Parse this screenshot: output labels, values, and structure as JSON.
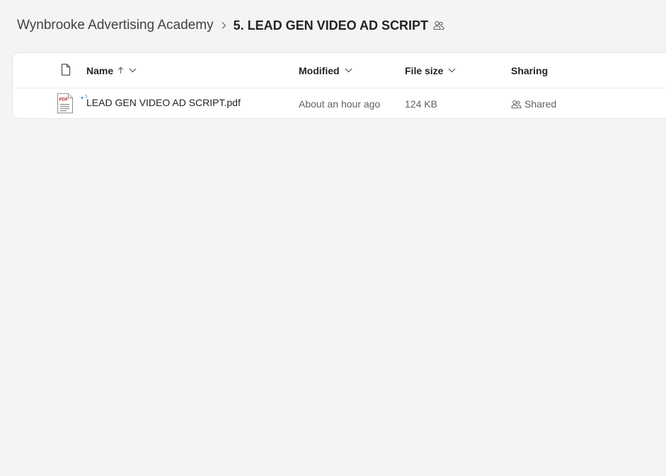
{
  "breadcrumb": {
    "parent": "Wynbrooke Advertising Academy",
    "current": "5. LEAD GEN VIDEO AD SCRIPT"
  },
  "columns": {
    "name": "Name",
    "modified": "Modified",
    "file_size": "File size",
    "sharing": "Sharing"
  },
  "files": [
    {
      "name": "LEAD GEN VIDEO AD SCRIPT.pdf",
      "type_badge": "PDF",
      "modified": "About an hour ago",
      "size": "124 KB",
      "sharing": "Shared"
    }
  ],
  "icons": {
    "file_header": "file-icon",
    "sort": "arrow-up-icon",
    "chevron": "chevron-down-icon",
    "shared": "people-icon",
    "sync": "sync-icon",
    "pdf": "pdf-file-icon"
  },
  "colors": {
    "background": "#f4f4f4",
    "card": "#ffffff",
    "pdf_red": "#c4262e",
    "sync_blue": "#2e8ab8"
  }
}
